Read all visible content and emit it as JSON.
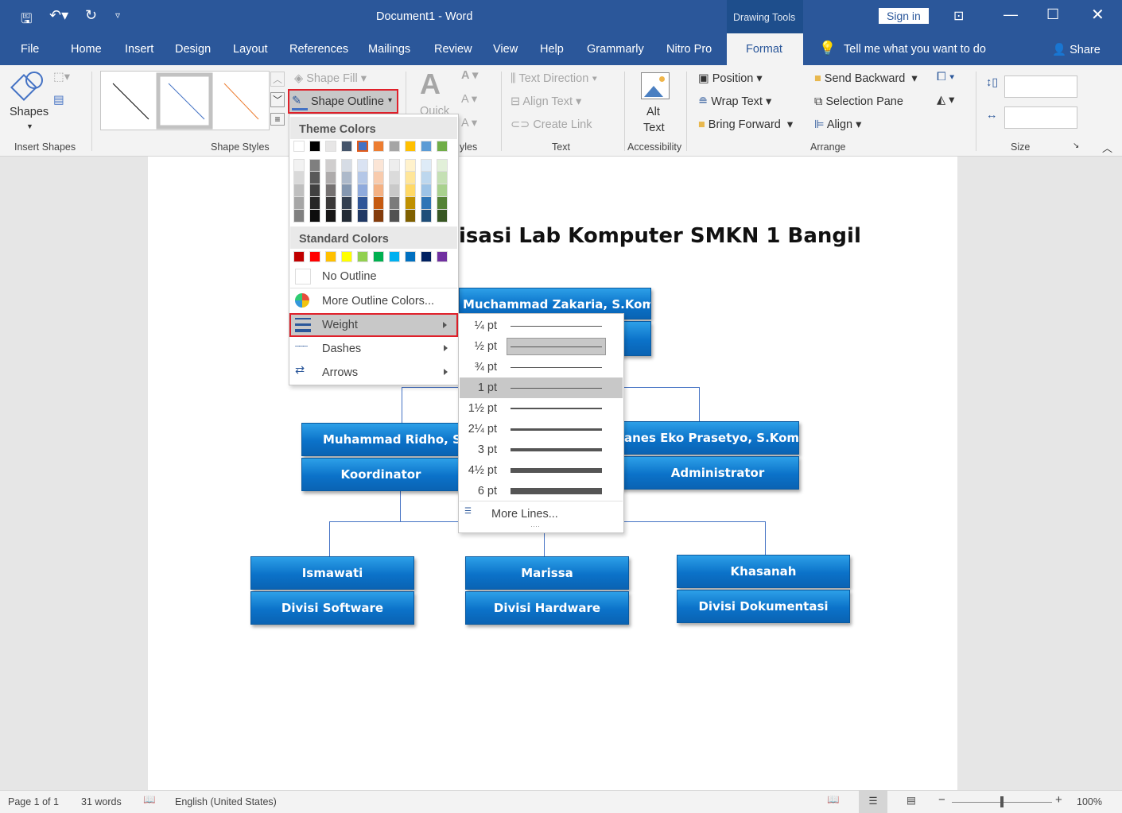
{
  "titlebar": {
    "document_title": "Document1  -  Word",
    "context_tab": "Drawing Tools",
    "sign_in": "Sign in"
  },
  "tabs": [
    "File",
    "Home",
    "Insert",
    "Design",
    "Layout",
    "References",
    "Mailings",
    "Review",
    "View",
    "Help",
    "Grammarly",
    "Nitro Pro",
    "Format"
  ],
  "active_tab": "Format",
  "tell_me": "Tell me what you want to do",
  "share": "Share",
  "ribbon": {
    "insert_shapes": {
      "shapes": "Shapes",
      "group": "Insert Shapes"
    },
    "shape_styles": {
      "shape_fill": "Shape Fill",
      "shape_outline": "Shape Outline",
      "group": "Shape Styles"
    },
    "wordart": {
      "quick": "Quick",
      "group_partial": "yles"
    },
    "text": {
      "text_direction": "Text Direction",
      "align_text": "Align Text",
      "create_link": "Create Link",
      "group": "Text"
    },
    "accessibility": {
      "alt_line1": "Alt",
      "alt_line2": "Text",
      "group": "Accessibility"
    },
    "arrange": {
      "position": "Position",
      "wrap_text": "Wrap Text",
      "bring_forward": "Bring Forward",
      "send_backward": "Send Backward",
      "selection_pane": "Selection Pane",
      "align": "Align",
      "group": "Arrange"
    },
    "size": {
      "height": "",
      "width": "",
      "group": "Size"
    }
  },
  "outline_menu": {
    "theme_colors_label": "Theme Colors",
    "theme_colors": [
      "#ffffff",
      "#000000",
      "#e7e6e6",
      "#44546a",
      "#4472c4",
      "#ed7d31",
      "#a5a5a5",
      "#ffc000",
      "#5b9bd5",
      "#70ad47"
    ],
    "selected_color": "#4472c4",
    "shades": [
      [
        "#f2f2f2",
        "#d9d9d9",
        "#bfbfbf",
        "#a6a6a6",
        "#808080"
      ],
      [
        "#7f7f7f",
        "#595959",
        "#404040",
        "#262626",
        "#0d0d0d"
      ],
      [
        "#d0cece",
        "#aeabab",
        "#757171",
        "#3a3838",
        "#171616"
      ],
      [
        "#d6dce5",
        "#adb9ca",
        "#8497b0",
        "#333f50",
        "#222a35"
      ],
      [
        "#dae3f3",
        "#b4c7e7",
        "#8faadc",
        "#2f5597",
        "#203864"
      ],
      [
        "#fbe5d6",
        "#f8cbad",
        "#f4b183",
        "#c55a11",
        "#843c0c"
      ],
      [
        "#ededed",
        "#dbdbdb",
        "#c9c9c9",
        "#7b7b7b",
        "#525252"
      ],
      [
        "#fff2cc",
        "#ffe699",
        "#ffd966",
        "#bf9000",
        "#7f6000"
      ],
      [
        "#deebf7",
        "#bdd7ee",
        "#9dc3e6",
        "#2e75b6",
        "#1f4e79"
      ],
      [
        "#e2f0d9",
        "#c5e0b4",
        "#a9d18e",
        "#548235",
        "#385723"
      ]
    ],
    "standard_colors_label": "Standard Colors",
    "standard_colors": [
      "#c00000",
      "#ff0000",
      "#ffc000",
      "#ffff00",
      "#92d050",
      "#00b050",
      "#00b0f0",
      "#0070c0",
      "#002060",
      "#7030a0"
    ],
    "no_outline": "No Outline",
    "more_colors": "More Outline Colors...",
    "weight": "Weight",
    "dashes": "Dashes",
    "arrows": "Arrows"
  },
  "weight_menu": {
    "items": [
      {
        "label": "¼ pt",
        "pt": 0.25
      },
      {
        "label": "½ pt",
        "pt": 0.5
      },
      {
        "label": "¾ pt",
        "pt": 0.75
      },
      {
        "label": "1 pt",
        "pt": 1
      },
      {
        "label": "1½ pt",
        "pt": 1.5
      },
      {
        "label": "2¼ pt",
        "pt": 2.25
      },
      {
        "label": "3 pt",
        "pt": 3
      },
      {
        "label": "4½ pt",
        "pt": 4.5
      },
      {
        "label": "6 pt",
        "pt": 6
      }
    ],
    "hovered": "½ pt",
    "selected": "1 pt",
    "more_lines": "More Lines..."
  },
  "document": {
    "title": "isasi Lab Komputer SMKN 1 Bangil",
    "top": {
      "name": "Muchammad Zakaria, S.Kom"
    },
    "left": {
      "name": "Muhammad Ridho, S.I",
      "role": "Koordinator"
    },
    "right": {
      "name": "anes Eko Prasetyo, S.Kom",
      "role": "Administrator"
    },
    "bottom": [
      {
        "name": "Ismawati",
        "role": "Divisi Software"
      },
      {
        "name": "Marissa",
        "role": "Divisi Hardware"
      },
      {
        "name": "Khasanah",
        "role": "Divisi Dokumentasi"
      }
    ]
  },
  "status": {
    "page": "Page 1 of 1",
    "words": "31 words",
    "language": "English (United States)",
    "zoom": "100%",
    "zoom_level": 100
  }
}
